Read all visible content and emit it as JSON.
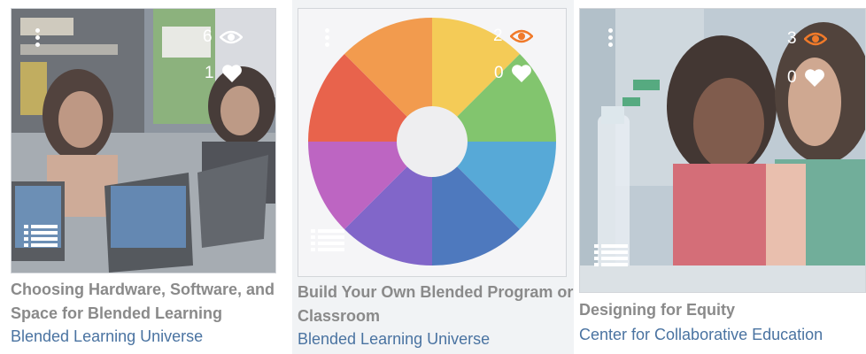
{
  "cards": [
    {
      "title": "Choosing Hardware, Software, and Space for Blended Learning",
      "source": "Blended Learning Universe",
      "views": "6",
      "likes": "1",
      "eye_icon_color": "#ffffff"
    },
    {
      "title": "Build Your Own Blended Program or Classroom",
      "source": "Blended Learning Universe",
      "views": "2",
      "likes": "0",
      "eye_icon_color": "#f07a2a"
    },
    {
      "title": "Designing for Equity",
      "source": "Center for Collaborative Education",
      "views": "3",
      "likes": "0",
      "eye_icon_color": "#f07a2a"
    }
  ],
  "colors": {
    "title": "#8a8a8a",
    "source_link": "#4a73a1",
    "viewed_eye": "#f07a2a"
  },
  "icons": [
    "more-vertical-icon",
    "eye-icon",
    "heart-icon",
    "list-icon"
  ]
}
